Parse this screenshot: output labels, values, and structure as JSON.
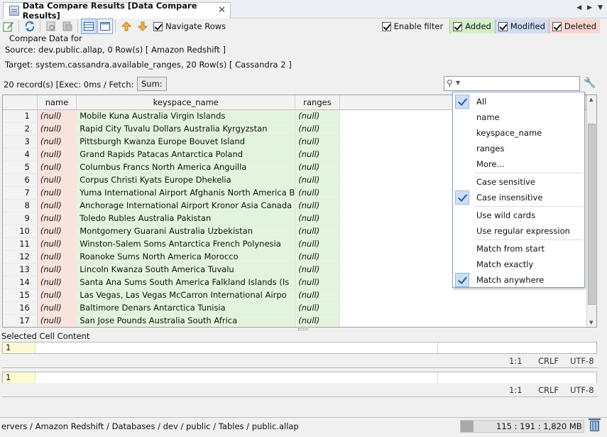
{
  "tab": {
    "title": "Data Compare Results [Data Compare Results]",
    "close": "✕"
  },
  "tabnav": {
    "left": "◀",
    "right": "▶",
    "menu": "▼"
  },
  "toolbar": {
    "navigate_rows_label": "Navigate Rows",
    "navigate_rows_checked": true,
    "enable_filter_label": "Enable filter",
    "added_label": "Added",
    "modified_label": "Modified",
    "deleted_label": "Deleted"
  },
  "compare": {
    "legend": "Compare Data for",
    "source": "Source: dev.public.allap, 0 Row(s) [ Amazon Redshift ]",
    "target": "Target: system.cassandra.available_ranges, 20 Row(s) [ Cassandra 2 ]"
  },
  "status": {
    "records": "20 record(s) [Exec: 0ms / Fetch: 0ms]",
    "sum_label": "Sum:"
  },
  "grid": {
    "columns": [
      "",
      "name",
      "keyspace_name",
      "ranges"
    ],
    "rows": [
      [
        "1",
        "(null)",
        "Mobile Kuna Australia Virgin Islands",
        "(null)"
      ],
      [
        "2",
        "(null)",
        "Rapid City Tuvalu Dollars Australia Kyrgyzstan",
        "(null)"
      ],
      [
        "3",
        "(null)",
        "Pittsburgh Kwanza Europe Bouvet Island",
        "(null)"
      ],
      [
        "4",
        "(null)",
        "Grand Rapids Patacas Antarctica Poland",
        "(null)"
      ],
      [
        "5",
        "(null)",
        "Columbus Francs North America Anguilla",
        "(null)"
      ],
      [
        "6",
        "(null)",
        "Corpus Christi Kyats Europe Dhekelia",
        "(null)"
      ],
      [
        "7",
        "(null)",
        "Yuma International Airport Afghanis North America B",
        "(null)"
      ],
      [
        "8",
        "(null)",
        "Anchorage International Airport Kronor Asia Canada",
        "(null)"
      ],
      [
        "9",
        "(null)",
        "Toledo Rubles Australia Pakistan",
        "(null)"
      ],
      [
        "10",
        "(null)",
        "Montgomery Guarani Australia Uzbekistan",
        "(null)"
      ],
      [
        "11",
        "(null)",
        "Winston-Salem Soms Antarctica French Polynesia",
        "(null)"
      ],
      [
        "12",
        "(null)",
        "Roanoke Sums North America Morocco",
        "(null)"
      ],
      [
        "13",
        "(null)",
        "Lincoln Kwanza South America Tuvalu",
        "(null)"
      ],
      [
        "14",
        "(null)",
        "Santa Ana Sums South America Falkland Islands (Is",
        "(null)"
      ],
      [
        "15",
        "(null)",
        "Las Vegas, Las Vegas McCarron International Airpo",
        "(null)"
      ],
      [
        "16",
        "(null)",
        "Baltimore Denars Antarctica Tunisia",
        "(null)"
      ],
      [
        "17",
        "(null)",
        "San Jose Pounds Australia South Africa",
        "(null)"
      ]
    ]
  },
  "menu": {
    "items": [
      {
        "label": "All",
        "checked": true
      },
      {
        "label": "name",
        "checked": false
      },
      {
        "label": "keyspace_name",
        "checked": false
      },
      {
        "label": "ranges",
        "checked": false
      },
      {
        "label": "More...",
        "checked": false
      },
      {
        "label": "Case sensitive",
        "checked": false
      },
      {
        "label": "Case insensitive",
        "checked": true
      },
      {
        "label": "Use wild cards",
        "checked": false
      },
      {
        "label": "Use regular expression",
        "checked": false
      },
      {
        "label": "Match from start",
        "checked": false
      },
      {
        "label": "Match exactly",
        "checked": false
      },
      {
        "label": "Match anywhere",
        "checked": true
      }
    ]
  },
  "cell_content": {
    "label": "Selected Cell Content",
    "line1": "1",
    "line2": "1",
    "status1": {
      "position": "1:1",
      "eol": "CRLF",
      "encoding": "UTF-8"
    },
    "status2": {
      "position": "1:1",
      "eol": "CRLF",
      "encoding": "UTF-8"
    }
  },
  "footer": {
    "path": "ervers / Amazon Redshift / Databases / dev / public / Tables / public.allap",
    "memory": "115 : 191 : 1,820 MB",
    "memory_used_fraction": 0.105
  }
}
